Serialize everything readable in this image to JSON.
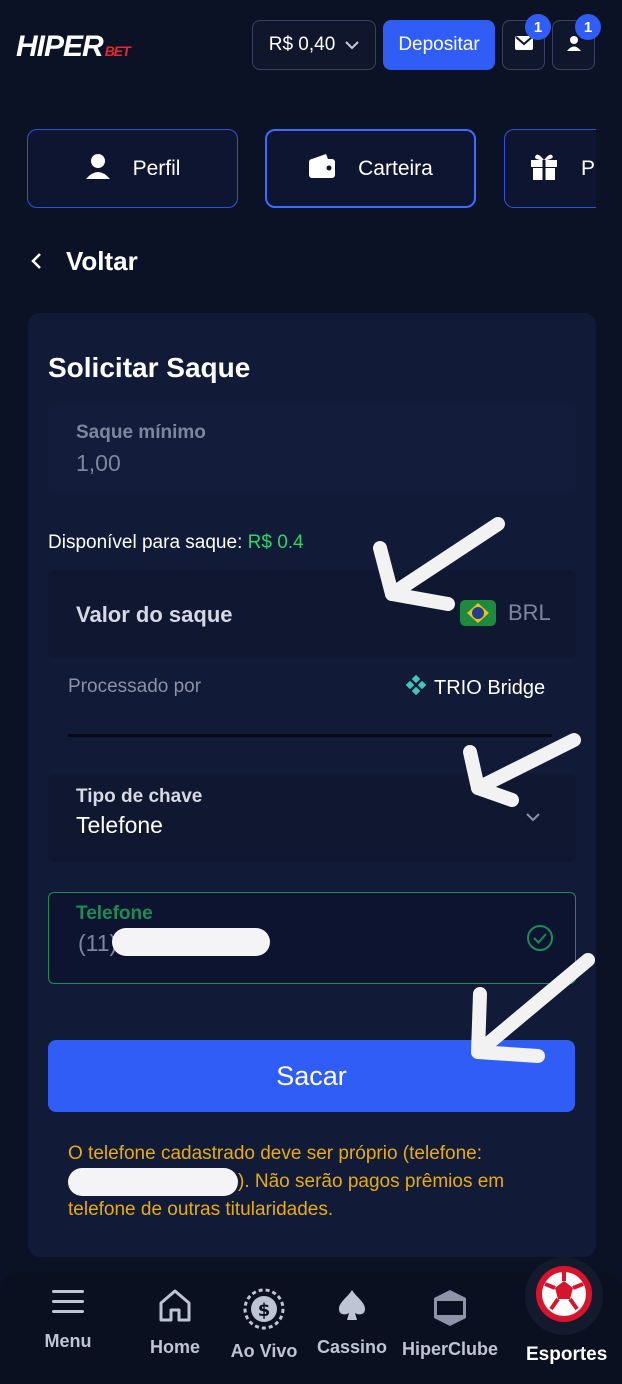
{
  "header": {
    "logo_main": "HIPER",
    "logo_sub": "BET",
    "balance": "R$ 0,40",
    "deposit_label": "Depositar",
    "mail_badge": "1",
    "user_badge": "1"
  },
  "tabs": [
    {
      "label": "Perfil",
      "icon": "user-icon"
    },
    {
      "label": "Carteira",
      "icon": "wallet-icon"
    },
    {
      "label": "Pr",
      "icon": "gift-icon"
    }
  ],
  "back_label": "Voltar",
  "withdraw": {
    "title": "Solicitar Saque",
    "min_label": "Saque mínimo",
    "min_value": "1,00",
    "available_label": "Disponível para saque:",
    "available_amount": "R$ 0.4",
    "amount_label": "Valor do saque",
    "currency": "BRL",
    "processed_label": "Processado por",
    "processor": "TRIO Bridge",
    "key_type_label": "Tipo de chave",
    "key_type_value": "Telefone",
    "phone_label": "Telefone",
    "phone_prefix": "(11)",
    "submit_label": "Sacar",
    "note_part1": "O telefone cadastrado deve ser próprio (telefone:",
    "note_part2": "). Não serão pagos prêmios em telefone de outras titularidades."
  },
  "bottom_nav": [
    {
      "label": "Menu",
      "icon": "menu-icon"
    },
    {
      "label": "Home",
      "icon": "home-icon"
    },
    {
      "label": "Ao Vivo",
      "icon": "live-coin-icon"
    },
    {
      "label": "Cassino",
      "icon": "spade-icon"
    },
    {
      "label": "HiperClube",
      "icon": "hiperclube-icon"
    },
    {
      "label": "Esportes",
      "icon": "soccer-ball-icon"
    }
  ],
  "colors": {
    "background": "#0c1226",
    "accent": "#2f5df5",
    "success": "#2ed36a",
    "warning": "#e6ac12"
  }
}
